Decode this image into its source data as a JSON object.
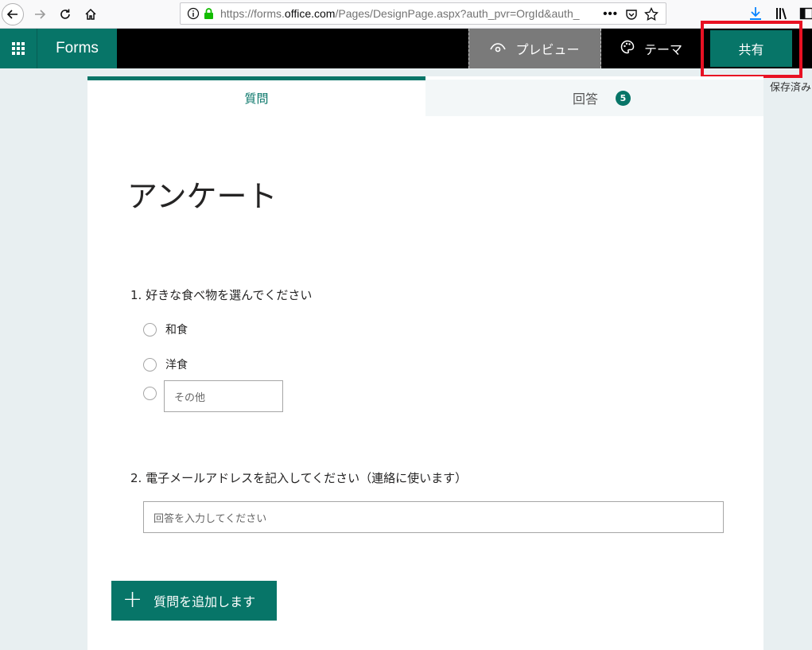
{
  "browser": {
    "url_prefix": "https://forms.",
    "url_domain": "office.com",
    "url_suffix": "/Pages/DesignPage.aspx?auth_pvr=OrgId&auth_",
    "more_label": "•••"
  },
  "header": {
    "app_name": "Forms",
    "preview_label": "プレビュー",
    "theme_label": "テーマ",
    "share_label": "共有",
    "saved_status": "保存済み"
  },
  "tabs": {
    "questions_label": "質問",
    "responses_label": "回答",
    "responses_count": "5"
  },
  "form": {
    "title": "アンケート",
    "questions": [
      {
        "title": "1. 好きな食べ物を選んでください",
        "options": [
          "和食",
          "洋食"
        ],
        "other_placeholder": "その他"
      },
      {
        "title": "2. 電子メールアドレスを記入してください（連絡に使います）",
        "answer_placeholder": "回答を入力してください"
      }
    ],
    "add_question_label": "質問を追加します",
    "add_question_icon": "+"
  },
  "colors": {
    "brand": "#077568",
    "highlight": "#e81123"
  }
}
